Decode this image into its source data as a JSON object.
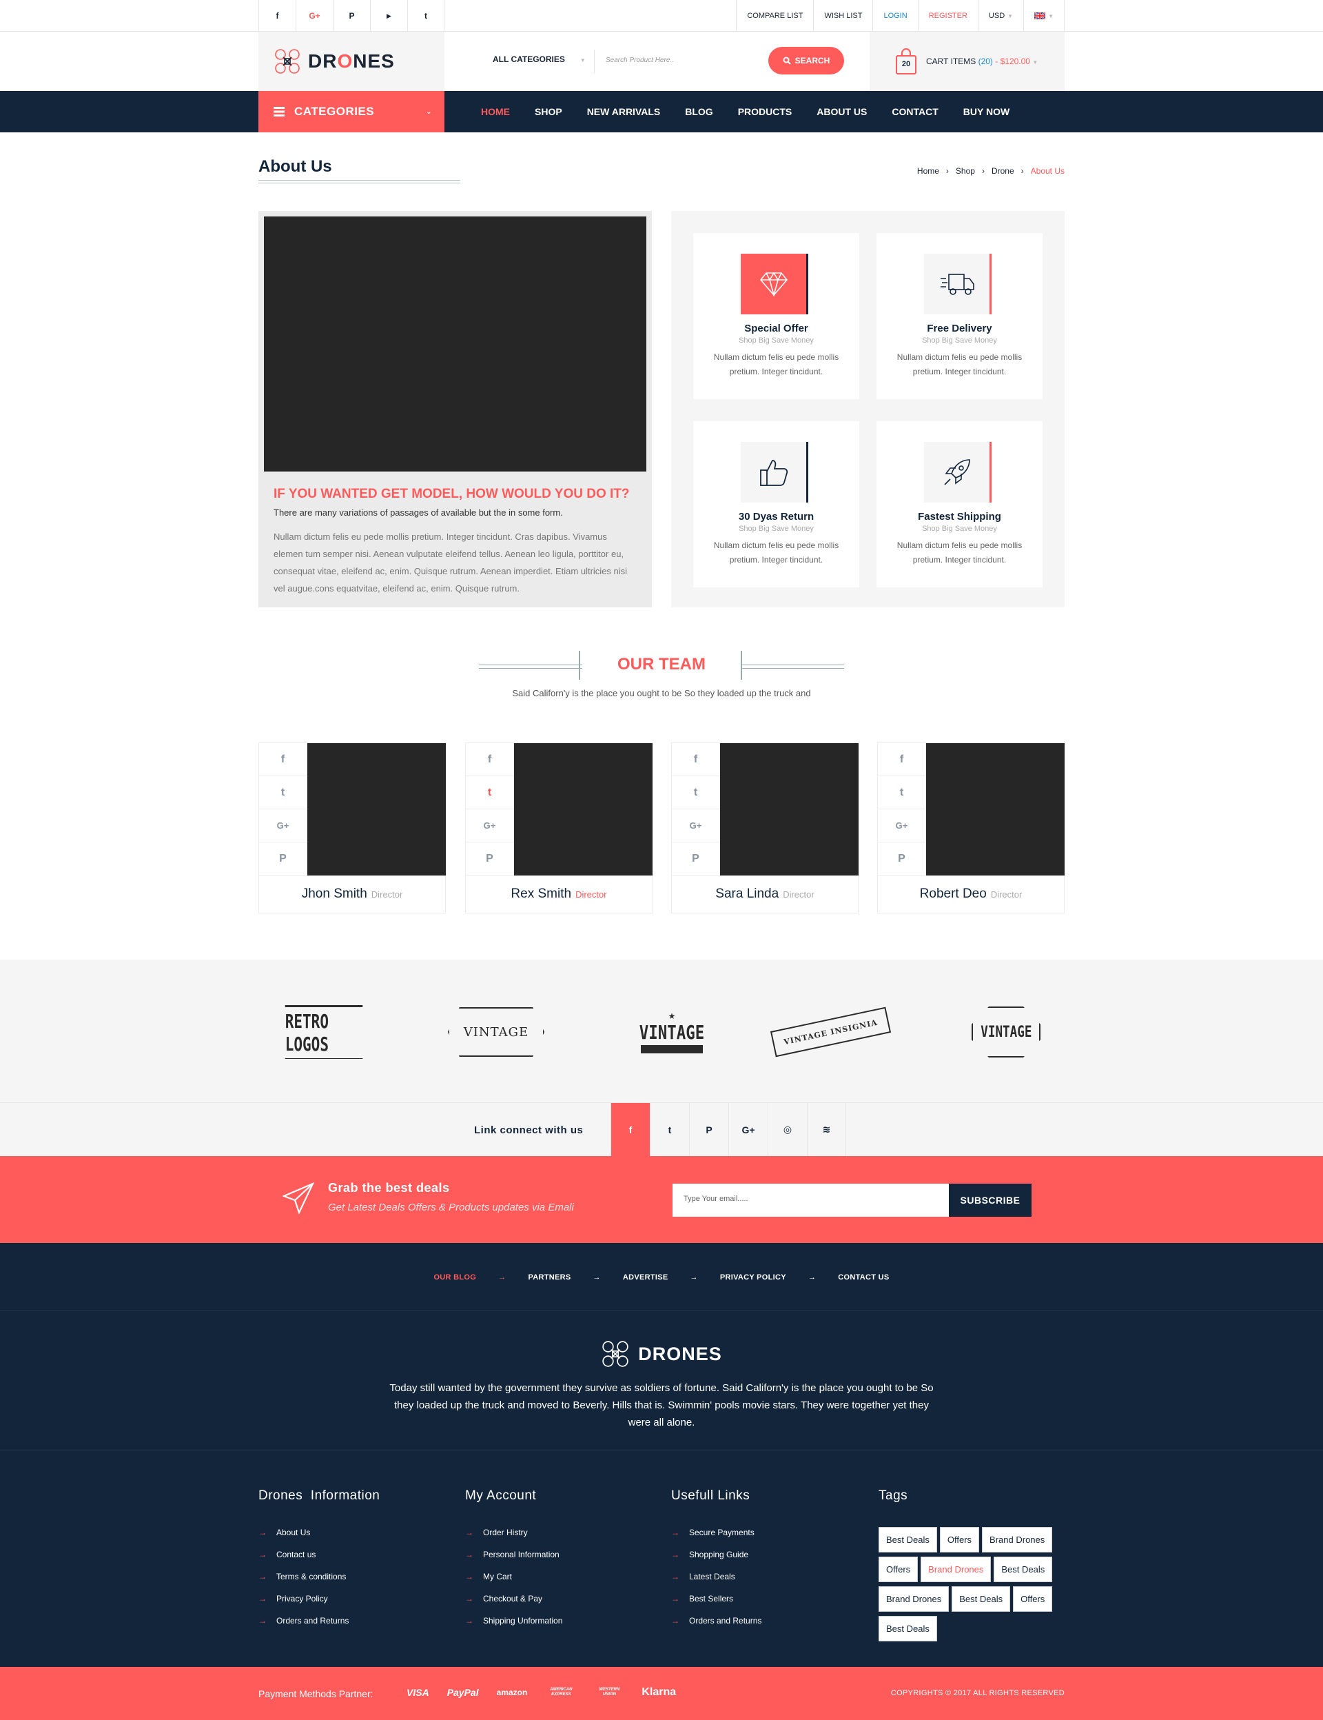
{
  "top_social": [
    "f",
    "G+",
    "P",
    "▶",
    "t"
  ],
  "top_links": {
    "compare": "COMPARE LIST",
    "wish": "WISH LIST",
    "login": "LOGIN",
    "register": "REGISTER",
    "currency": "USD"
  },
  "header": {
    "logo": "DRONES",
    "category_select": "ALL CATEGORIES",
    "search_placeholder": "Search Product Here..",
    "search_button": "SEARCH",
    "cart_count": "20",
    "cart_label": "CART ITEMS",
    "cart_items": "(20)",
    "cart_total": "- $120.00"
  },
  "nav": {
    "categories": "CATEGORIES",
    "items": [
      "HOME",
      "SHOP",
      "NEW ARRIVALS",
      "BLOG",
      "PRODUCTS",
      "ABOUT US",
      "CONTACT",
      "BUY NOW"
    ]
  },
  "page": {
    "title": "About Us",
    "breadcrumb": [
      "Home",
      "Shop",
      "Drone",
      "About Us"
    ]
  },
  "about": {
    "heading": "IF YOU WANTED GET MODEL, HOW WOULD YOU DO IT?",
    "subheading": "There are many variations of passages of available but the in some form.",
    "body": "Nullam dictum felis eu pede mollis pretium. Integer tincidunt. Cras dapibus. Vivamus elemen tum semper nisi. Aenean vulputate eleifend tellus. Aenean leo ligula, porttitor eu, consequat vitae, eleifend ac, enim. Quisque rutrum. Aenean imperdiet. Etiam ultricies nisi vel augue.cons equatvitae, eleifend ac, enim. Quisque rutrum."
  },
  "features": [
    {
      "title": "Special Offer",
      "sub": "Shop Big Save Money",
      "desc": "Nullam dictum felis eu pede mollis pretium. Integer tincidunt.",
      "icon": "diamond-icon"
    },
    {
      "title": "Free Delivery",
      "sub": "Shop Big Save Money",
      "desc": "Nullam dictum felis eu pede mollis pretium. Integer tincidunt.",
      "icon": "truck-icon"
    },
    {
      "title": "30 Dyas Return",
      "sub": "Shop Big Save Money",
      "desc": "Nullam dictum felis eu pede mollis pretium. Integer tincidunt.",
      "icon": "thumbs-up-icon"
    },
    {
      "title": "Fastest Shipping",
      "sub": "Shop Big Save Money",
      "desc": "Nullam dictum felis eu pede mollis pretium. Integer tincidunt.",
      "icon": "rocket-icon"
    }
  ],
  "team": {
    "title": "OUR TEAM",
    "subtitle": "Said Californ'y is the place you ought to be So they loaded up the truck and",
    "members": [
      {
        "name": "Jhon Smith",
        "role": "Director"
      },
      {
        "name": "Rex Smith",
        "role": "Director"
      },
      {
        "name": "Sara Linda",
        "role": "Director"
      },
      {
        "name": "Robert Deo",
        "role": "Director"
      }
    ]
  },
  "brands": [
    "RETRO LOGOS",
    "VINTAGE",
    "VINTAGE",
    "VINTAGE INSIGNIA",
    "VINTAGE"
  ],
  "connect": {
    "label": "Link connect with us",
    "icons": [
      "f",
      "t",
      "P",
      "G+",
      "◎",
      "≋"
    ]
  },
  "deals": {
    "title": "Grab the best deals",
    "subtitle": "Get Latest Deals Offers & Products updates via Emali",
    "email_placeholder": "Type Your email.....",
    "button": "SUBSCRIBE"
  },
  "footer": {
    "links": [
      "OUR BLOG",
      "PARTNERS",
      "ADVERTISE",
      "PRIVACY POLICY",
      "CONTACT US"
    ],
    "logo": "DRONES",
    "about": "Today still wanted by the government they survive as soldiers of fortune. Said Californ'y is the place you ought to be So they loaded up the truck and moved to Beverly. Hills that is. Swimmin' pools movie stars. They were together yet they were all alone.",
    "columns": [
      {
        "heading": "Drones  Information",
        "items": [
          "About Us",
          "Contact us",
          "Terms & conditions",
          "Privacy Policy",
          "Orders and Returns"
        ]
      },
      {
        "heading": "My Account",
        "items": [
          "Order Histry",
          "Personal Information",
          "My Cart",
          "Checkout & Pay",
          "Shipping Unformation"
        ]
      },
      {
        "heading": "Usefull Links",
        "items": [
          "Secure Payments",
          "Shopping Guide",
          "Latest Deals",
          "Best Sellers",
          "Orders and Returns"
        ]
      }
    ],
    "tags_heading": "Tags",
    "tags": [
      "Best Deals",
      "Offers",
      "Brand Drones",
      "Offers",
      "Brand Drones",
      "Best Deals",
      "Brand Drones",
      "Best Deals",
      "Offers",
      "Best Deals"
    ]
  },
  "bottom": {
    "payment_label": "Payment Methods Partner:",
    "payments": [
      "VISA",
      "PayPal",
      "amazon",
      "AMERICAN EXPRESS",
      "WESTERN UNION",
      "Klarna"
    ],
    "copyright": "COPYRIGHTS © 2017 ALL RIGHTS RESERVED"
  },
  "colors": {
    "accent": "#ff5b5b",
    "navy": "#12253b",
    "light": "#f5f5f5"
  }
}
